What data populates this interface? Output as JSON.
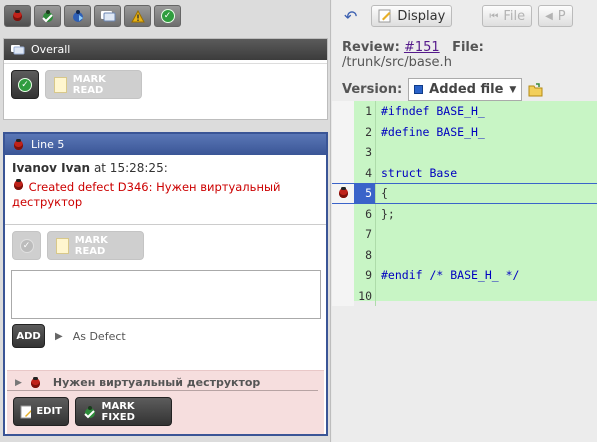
{
  "toolbar": {
    "buttons": [
      "bug-icon",
      "bug-green-icon",
      "bug-blue-icon",
      "comment-icon",
      "warning-icon",
      "check-icon"
    ]
  },
  "overall_panel": {
    "title": "Overall",
    "mark_read": "MARK READ"
  },
  "line_panel": {
    "title": "Line 5",
    "author": "Ivanov Ivan",
    "at": "at 15:28:25:",
    "comment": "Created defect D346: Нужен виртуальный деструктор",
    "mark_read": "MARK READ",
    "add_label": "ADD",
    "as_defect": "As Defect",
    "defect_title": "Нужен виртуальный деструктор",
    "edit_label": "EDIT",
    "mark_fixed_label": "MARK FIXED"
  },
  "right_toolbar": {
    "display_label": "Display",
    "file_label": "File",
    "p_label": "P"
  },
  "review": {
    "review_label": "Review:",
    "review_link": "#151",
    "file_label": "File:",
    "file_path": "/trunk/src/base.h",
    "version_label": "Version:",
    "version_value": "Added file"
  },
  "code_lines": [
    {
      "num": "1",
      "text": "#ifndef BASE_H_"
    },
    {
      "num": "2",
      "text": "#define BASE_H_"
    },
    {
      "num": "3",
      "text": ""
    },
    {
      "num": "4",
      "text": "struct Base"
    },
    {
      "num": "5",
      "text": "{"
    },
    {
      "num": "6",
      "text": "};"
    },
    {
      "num": "7",
      "text": ""
    },
    {
      "num": "8",
      "text": ""
    },
    {
      "num": "9",
      "text": "#endif /* BASE_H_ */"
    },
    {
      "num": "10",
      "text": ""
    }
  ]
}
